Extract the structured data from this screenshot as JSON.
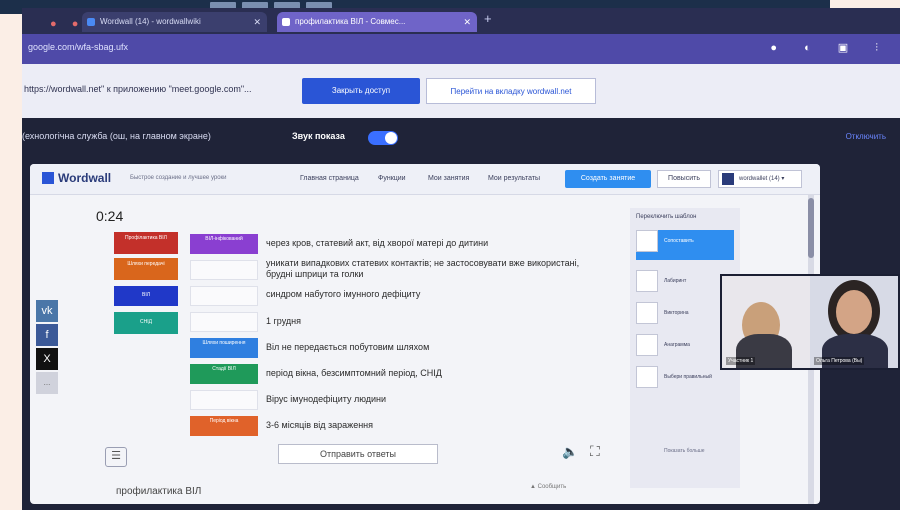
{
  "browser": {
    "tab1": "Wordwall (14) - wordwallwiki",
    "tab2": "профилактика ВІЛ - Совмес...",
    "address": "google.com/wfa-sbag.ufx"
  },
  "infobar": {
    "message": "https://wordwall.net\" к приложению \"meet.google.com\"...",
    "share_button": "Закрыть доступ",
    "goto_button": "Перейти на вкладку wordwall.net"
  },
  "meet": {
    "title": "(ехнологічна служба (ош, на главном экране)",
    "sound_label": "Звук показа",
    "right_link": "Отключить"
  },
  "wordwall": {
    "logo": "Wordwall",
    "tagline": "Быстрое создание и лучшее уроки",
    "nav": [
      "Главная страница",
      "Функции",
      "Мои занятия",
      "Мои результаты"
    ],
    "create_button": "Создать занятие",
    "upgrade_button": "Повысить",
    "account": "wordwallet (14)",
    "timer": "0:24",
    "tiles": [
      {
        "label": "Профілактика ВІЛ",
        "color": "#c3302a"
      },
      {
        "label": "Шляхи передачі",
        "color": "#d9661c"
      },
      {
        "label": "ВІЛ",
        "color": "#2038c8"
      },
      {
        "label": "СНІД",
        "color": "#1aa08a"
      }
    ],
    "slots": [
      {
        "label": "ВІЛ-інфікований",
        "color": "#8a3fd1"
      },
      {
        "label": "",
        "color": ""
      },
      {
        "label": "",
        "color": ""
      },
      {
        "label": "",
        "color": ""
      },
      {
        "label": "Шляхи поширення",
        "color": "#2f7fe0"
      },
      {
        "label": "Стадії ВІЛ",
        "color": "#1f9a5a"
      },
      {
        "label": "",
        "color": ""
      },
      {
        "label": "Період вікна",
        "color": "#e0622a"
      }
    ],
    "descriptions": [
      "через кров, статевий акт, від хворої матері до дитини",
      "уникати випадкових статевих контактів; не застосовувати вже використані, брудні шприци та голки",
      "синдром набутого імунного дефіциту",
      "1 грудня",
      "Віл не передається побутовим шляхом",
      "період вікна, безсимптомний період, СНІД",
      "Вірус імунодефіциту людини",
      "3-6 місяців від зараження"
    ],
    "submit_button": "Отправить ответы",
    "page_title": "профилактика ВІЛ",
    "report": "Сообщить",
    "themes_header": "Переключить шаблон",
    "themes": [
      "Сопоставить",
      "Лабиринт",
      "Викторина",
      "Анаграмма",
      "Выбери правильный"
    ],
    "themes_more": "Показать больше",
    "social": [
      "vk",
      "f",
      "X",
      "..."
    ]
  },
  "participants": [
    {
      "name": "Участник 1"
    },
    {
      "name": "Ольга Петрова (Вы)"
    }
  ]
}
